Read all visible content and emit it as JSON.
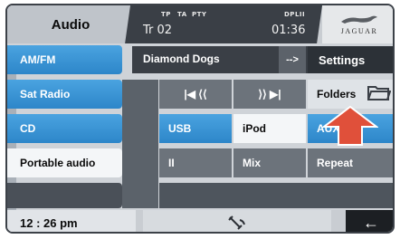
{
  "header": {
    "title": "Audio",
    "indicators": [
      "TP",
      "TA",
      "PTY"
    ],
    "dolby": "DPLII",
    "track": "Tr 02",
    "clock": "01:36",
    "brand": "JAGUAR"
  },
  "sources": [
    {
      "label": "AM/FM",
      "state": "selected"
    },
    {
      "label": "Sat Radio",
      "state": "highlighted"
    },
    {
      "label": "CD",
      "state": "highlighted"
    },
    {
      "label": "Portable audio",
      "state": "normal"
    }
  ],
  "now_playing": {
    "title": "Diamond Dogs",
    "next": "-->",
    "settings": "Settings"
  },
  "controls": {
    "prev_label": "|◀ ⟨⟨",
    "next_label": "⟩⟩ ▶|",
    "folders": "Folders",
    "usb": "USB",
    "ipod": "iPod",
    "aux": "AUX",
    "pause": "II",
    "mix": "Mix",
    "repeat": "Repeat"
  },
  "footer": {
    "time": "12 : 26 pm",
    "back": "←"
  },
  "icons": [
    "jaguar-leaper-icon",
    "folder-icon",
    "up-arrow-icon",
    "satellite-icon",
    "back-arrow-icon"
  ],
  "colors": {
    "accent_blue": "#2d86c9",
    "dark_panel": "#3a3f46",
    "arrow_red": "#e0503a"
  }
}
